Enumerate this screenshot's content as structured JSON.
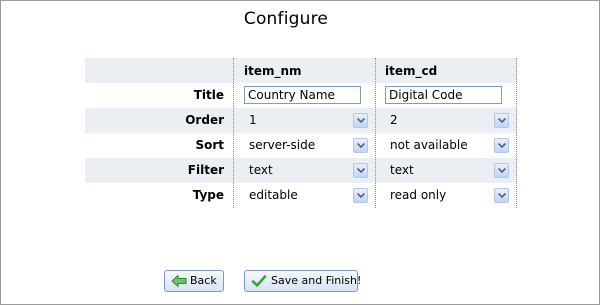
{
  "page": {
    "title": "Configure"
  },
  "columns": [
    {
      "name": "item_nm",
      "title": "Country Name",
      "order": "1",
      "sort": "server-side",
      "filter": "text",
      "type": "editable"
    },
    {
      "name": "item_cd",
      "title": "Digital Code",
      "order": "2",
      "sort": "not available",
      "filter": "text",
      "type": "read only"
    }
  ],
  "row_labels": {
    "title": "Title",
    "order": "Order",
    "sort": "Sort",
    "filter": "Filter",
    "type": "Type"
  },
  "buttons": {
    "back": "Back",
    "save_finish": "Save and Finish!"
  },
  "icons": {
    "dropdown": "chevron-down-icon",
    "back": "left-arrow-icon",
    "save": "checkmark-icon"
  },
  "colors": {
    "row_shade": "#ebeff4",
    "accent_green": "#3aa43a",
    "input_border": "#7f9db9"
  }
}
